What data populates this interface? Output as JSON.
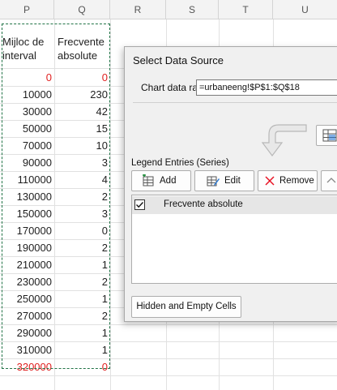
{
  "columns": [
    "P",
    "Q",
    "R",
    "S",
    "T",
    "U"
  ],
  "table": {
    "header_p": [
      "Mijloc de",
      "interval"
    ],
    "header_q": [
      "Frecvente",
      "absolute"
    ],
    "rows": [
      {
        "p": "0",
        "q": "0",
        "red": true
      },
      {
        "p": "10000",
        "q": "230",
        "red": false
      },
      {
        "p": "30000",
        "q": "42",
        "red": false
      },
      {
        "p": "50000",
        "q": "15",
        "red": false
      },
      {
        "p": "70000",
        "q": "10",
        "red": false
      },
      {
        "p": "90000",
        "q": "3",
        "red": false
      },
      {
        "p": "110000",
        "q": "4",
        "red": false
      },
      {
        "p": "130000",
        "q": "2",
        "red": false
      },
      {
        "p": "150000",
        "q": "3",
        "red": false
      },
      {
        "p": "170000",
        "q": "0",
        "red": false
      },
      {
        "p": "190000",
        "q": "2",
        "red": false
      },
      {
        "p": "210000",
        "q": "1",
        "red": false
      },
      {
        "p": "230000",
        "q": "2",
        "red": false
      },
      {
        "p": "250000",
        "q": "1",
        "red": false
      },
      {
        "p": "270000",
        "q": "2",
        "red": false
      },
      {
        "p": "290000",
        "q": "1",
        "red": false
      },
      {
        "p": "310000",
        "q": "1",
        "red": false
      },
      {
        "p": "320000",
        "q": "0",
        "red": true
      }
    ]
  },
  "dialog": {
    "title": "Select Data Source",
    "range_label": "Chart data range:",
    "range_value": "=urbaneeng!$P$1:$Q$18",
    "legend_label": "Legend Entries (Series)",
    "add_label": "Add",
    "edit_label": "Edit",
    "remove_label": "Remove",
    "series": [
      {
        "name": "Frecvente absolute",
        "checked": true
      }
    ],
    "hidden_cells_label": "Hidden and Empty Cells"
  },
  "colors": {
    "red_text": "#e02020",
    "marquee": "#217346",
    "remove_x": "#e81123"
  }
}
